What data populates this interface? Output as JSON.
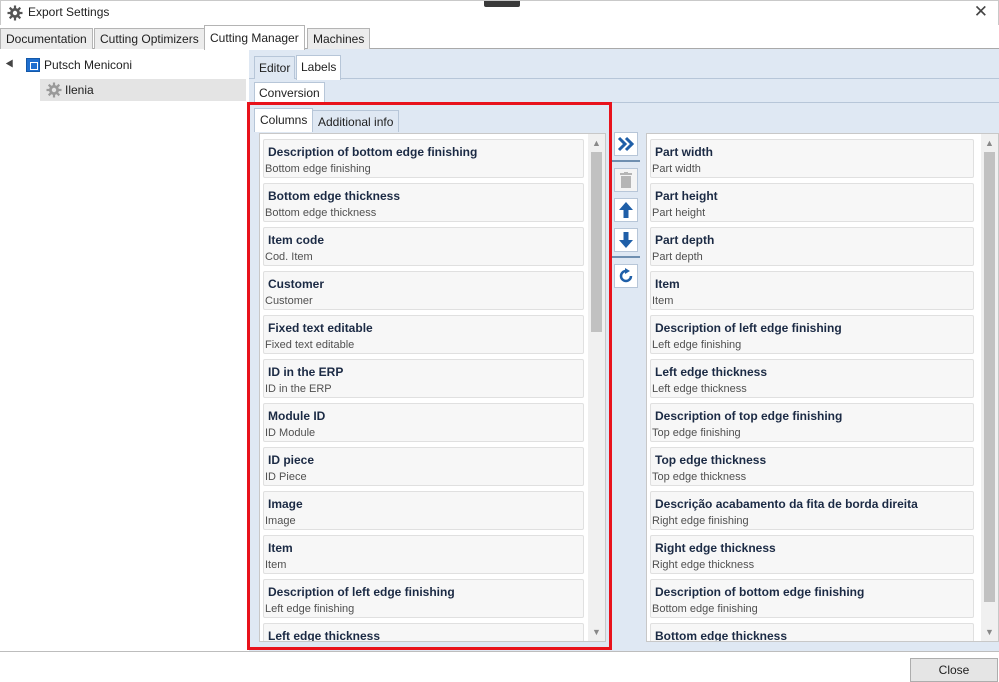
{
  "window": {
    "title": "Export Settings",
    "close_glyph": "✕"
  },
  "main_tabs": [
    "Documentation",
    "Cutting Optimizers",
    "Cutting Manager",
    "Machines"
  ],
  "tree": {
    "root": "Putsch Meniconi",
    "child": "Ilenia"
  },
  "sub_tabs": [
    "Editor",
    "Labels"
  ],
  "conversion_tab": "Conversion",
  "column_tabs": [
    "Columns",
    "Additional info"
  ],
  "available_columns": [
    {
      "title": "Description of bottom edge finishing",
      "sub": "Bottom edge finishing"
    },
    {
      "title": "Bottom edge thickness",
      "sub": "Bottom edge thickness"
    },
    {
      "title": "Item code",
      "sub": "Cod. Item"
    },
    {
      "title": "Customer",
      "sub": "Customer"
    },
    {
      "title": "Fixed text editable",
      "sub": "Fixed text editable"
    },
    {
      "title": "ID in the ERP",
      "sub": "ID in the ERP"
    },
    {
      "title": "Module ID",
      "sub": "ID Module"
    },
    {
      "title": "ID piece",
      "sub": "ID Piece"
    },
    {
      "title": "Image",
      "sub": "Image"
    },
    {
      "title": "Item",
      "sub": "Item"
    },
    {
      "title": "Description of left edge finishing",
      "sub": "Left edge finishing"
    },
    {
      "title": "Left edge thickness",
      "sub": ""
    }
  ],
  "selected_columns": [
    {
      "title": "Part width",
      "sub": "Part width"
    },
    {
      "title": "Part height",
      "sub": "Part height"
    },
    {
      "title": "Part depth",
      "sub": "Part depth"
    },
    {
      "title": "Item",
      "sub": "Item"
    },
    {
      "title": "Description of left edge finishing",
      "sub": "Left edge finishing"
    },
    {
      "title": "Left edge thickness",
      "sub": "Left edge thickness"
    },
    {
      "title": "Description of top edge finishing",
      "sub": "Top edge finishing"
    },
    {
      "title": "Top edge thickness",
      "sub": "Top edge thickness"
    },
    {
      "title": "Descrição acabamento da fita de borda direita",
      "sub": "Right edge finishing"
    },
    {
      "title": "Right edge thickness",
      "sub": "Right edge thickness"
    },
    {
      "title": "Description of bottom edge finishing",
      "sub": "Bottom edge finishing"
    },
    {
      "title": "Bottom edge thickness",
      "sub": ""
    }
  ],
  "toolbar_icons": [
    "double-chevron-right-icon",
    "trash-icon",
    "arrow-up-icon",
    "arrow-down-icon",
    "refresh-icon"
  ],
  "footer": {
    "close_label": "Close"
  },
  "colors": {
    "highlight_border": "#e8121b",
    "panel_bg": "#dfe8f3",
    "icon_blue": "#1f5fa8"
  }
}
